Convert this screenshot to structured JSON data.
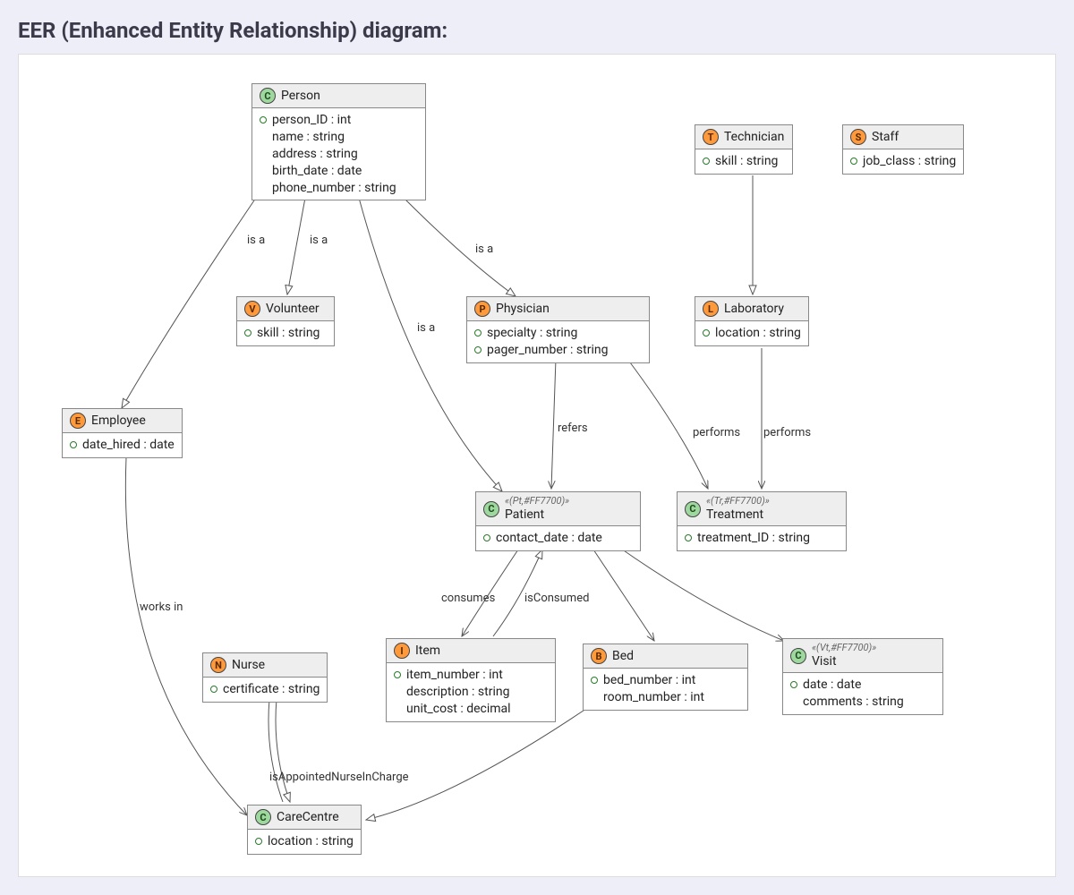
{
  "title": "EER (Enhanced Entity Relationship) diagram:",
  "entities": {
    "person": {
      "badge": "C",
      "badgeColor": "green",
      "name": "Person",
      "attrs": [
        {
          "dot": true,
          "text": "person_ID : int"
        },
        {
          "dot": false,
          "text": "name : string"
        },
        {
          "dot": false,
          "text": "address : string"
        },
        {
          "dot": false,
          "text": "birth_date : date"
        },
        {
          "dot": false,
          "text": "phone_number : string"
        }
      ]
    },
    "technician": {
      "badge": "T",
      "badgeColor": "orange",
      "name": "Technician",
      "attrs": [
        {
          "dot": true,
          "text": "skill : string"
        }
      ]
    },
    "staff": {
      "badge": "S",
      "badgeColor": "orange",
      "name": "Staff",
      "attrs": [
        {
          "dot": true,
          "text": "job_class : string"
        }
      ]
    },
    "volunteer": {
      "badge": "V",
      "badgeColor": "orange",
      "name": "Volunteer",
      "attrs": [
        {
          "dot": true,
          "text": "skill : string"
        }
      ]
    },
    "physician": {
      "badge": "P",
      "badgeColor": "orange",
      "name": "Physician",
      "attrs": [
        {
          "dot": true,
          "text": "specialty : string"
        },
        {
          "dot": true,
          "text": "pager_number : string"
        }
      ]
    },
    "laboratory": {
      "badge": "L",
      "badgeColor": "orange",
      "name": "Laboratory",
      "attrs": [
        {
          "dot": true,
          "text": "location : string"
        }
      ]
    },
    "employee": {
      "badge": "E",
      "badgeColor": "orange",
      "name": "Employee",
      "attrs": [
        {
          "dot": true,
          "text": "date_hired : date"
        }
      ]
    },
    "patient": {
      "badge": "C",
      "badgeColor": "green",
      "name": "Patient",
      "stereo": "«(Pt,#FF7700)»",
      "attrs": [
        {
          "dot": true,
          "text": "contact_date : date"
        }
      ]
    },
    "treatment": {
      "badge": "C",
      "badgeColor": "green",
      "name": "Treatment",
      "stereo": "«(Tr,#FF7700)»",
      "attrs": [
        {
          "dot": true,
          "text": "treatment_ID : string"
        }
      ]
    },
    "nurse": {
      "badge": "N",
      "badgeColor": "orange",
      "name": "Nurse",
      "attrs": [
        {
          "dot": true,
          "text": "certificate : string"
        }
      ]
    },
    "item": {
      "badge": "I",
      "badgeColor": "orange",
      "name": "Item",
      "attrs": [
        {
          "dot": true,
          "text": "item_number : int"
        },
        {
          "dot": false,
          "text": "description : string"
        },
        {
          "dot": false,
          "text": "unit_cost : decimal"
        }
      ]
    },
    "bed": {
      "badge": "B",
      "badgeColor": "orange",
      "name": "Bed",
      "attrs": [
        {
          "dot": true,
          "text": "bed_number : int"
        },
        {
          "dot": false,
          "text": "room_number : int"
        }
      ]
    },
    "visit": {
      "badge": "C",
      "badgeColor": "green",
      "name": "Visit",
      "stereo": "«(Vt,#FF7700)»",
      "attrs": [
        {
          "dot": true,
          "text": "date : date"
        },
        {
          "dot": false,
          "text": "comments : string"
        }
      ]
    },
    "carecentre": {
      "badge": "C",
      "badgeColor": "green",
      "name": "CareCentre",
      "attrs": [
        {
          "dot": true,
          "text": "location : string"
        }
      ]
    }
  },
  "edgeLabels": {
    "isa1": "is a",
    "isa2": "is a",
    "isa3": "is a",
    "isa4": "is a",
    "refers": "refers",
    "performs1": "performs",
    "performs2": "performs",
    "worksin": "works in",
    "consumes": "consumes",
    "isconsumed": "isConsumed",
    "nurseincharge": "isAppointedNurseInCharge"
  }
}
